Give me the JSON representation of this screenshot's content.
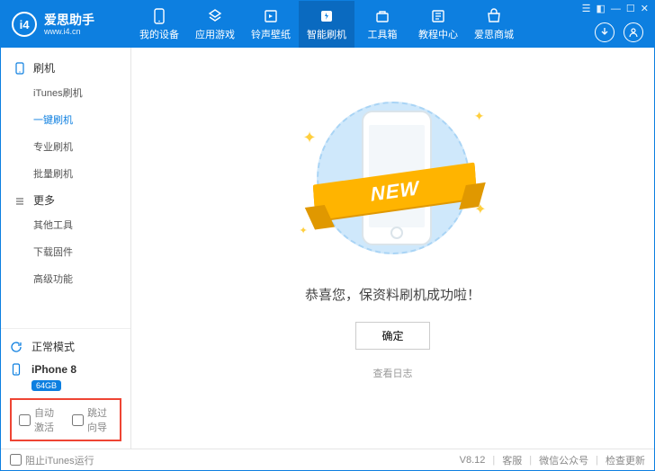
{
  "logo": {
    "badge": "i4",
    "title": "爱思助手",
    "subtitle": "www.i4.cn"
  },
  "tabs": [
    {
      "id": "devices",
      "label": "我的设备"
    },
    {
      "id": "apps",
      "label": "应用游戏"
    },
    {
      "id": "ringtones",
      "label": "铃声壁纸"
    },
    {
      "id": "flash",
      "label": "智能刷机",
      "active": true
    },
    {
      "id": "toolbox",
      "label": "工具箱"
    },
    {
      "id": "tutorial",
      "label": "教程中心"
    },
    {
      "id": "store",
      "label": "爱思商城"
    }
  ],
  "sidebar": {
    "groups": [
      {
        "title": "刷机",
        "items": [
          "iTunes刷机",
          "一键刷机",
          "专业刷机",
          "批量刷机"
        ],
        "activeIndex": 1
      },
      {
        "title": "更多",
        "items": [
          "其他工具",
          "下载固件",
          "高级功能"
        ],
        "activeIndex": -1
      }
    ],
    "mode": "正常模式",
    "device": {
      "name": "iPhone 8",
      "storage": "64GB"
    },
    "checkboxes": {
      "autoActivate": "自动激活",
      "skipGuide": "跳过向导"
    }
  },
  "main": {
    "ribbon": "NEW",
    "message": "恭喜您，保资料刷机成功啦！",
    "confirm": "确定",
    "viewLog": "查看日志"
  },
  "footer": {
    "blockItunes": "阻止iTunes运行",
    "version": "V8.12",
    "support": "客服",
    "wechat": "微信公众号",
    "checkUpdate": "检查更新"
  }
}
